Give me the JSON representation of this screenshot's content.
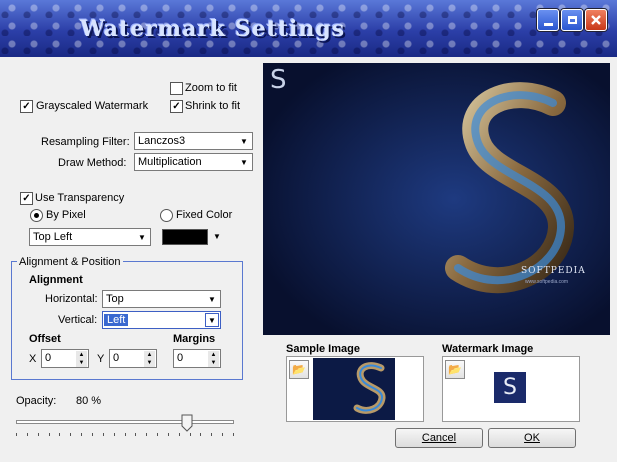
{
  "window": {
    "title": "Watermark Settings"
  },
  "options": {
    "zoom_to_fit": {
      "label": "Zoom to fit",
      "checked": false
    },
    "shrink_to_fit": {
      "label": "Shrink to fit",
      "checked": true
    },
    "grayscaled_watermark": {
      "label": "Grayscaled Watermark",
      "checked": true
    }
  },
  "resampling": {
    "label": "Resampling Filter:",
    "value": "Lanczos3"
  },
  "draw_method": {
    "label": "Draw Method:",
    "value": "Multiplication"
  },
  "transparency": {
    "label": "Use Transparency",
    "checked": true,
    "by_pixel": "By Pixel",
    "fixed_color": "Fixed Color",
    "pixel_position": "Top Left",
    "color": "#000000"
  },
  "alignment_group": {
    "legend": "Alignment & Position",
    "alignment_label": "Alignment",
    "horizontal_label": "Horizontal:",
    "horizontal_value": "Top",
    "vertical_label": "Vertical:",
    "vertical_value": "Left",
    "offset_label": "Offset",
    "margins_label": "Margins",
    "x_label": "X",
    "x_value": "0",
    "y_label": "Y",
    "y_value": "0",
    "margin_value": "0"
  },
  "opacity": {
    "label": "Opacity:",
    "value_text": "80 %",
    "value": 0.8
  },
  "preview": {
    "watermark_letter": "S",
    "brand_text": "SOFTPEDIA",
    "url_text": "www.softpedia.com"
  },
  "sample_image": {
    "label": "Sample Image"
  },
  "watermark_image": {
    "label": "Watermark Image",
    "letter": "S"
  },
  "buttons": {
    "cancel": "Cancel",
    "ok": "OK"
  },
  "colors": {
    "title_bar": "#2c3fa8",
    "preview_bg": "#0c1a45",
    "accent": "#3a68d0",
    "close": "#c83818"
  }
}
